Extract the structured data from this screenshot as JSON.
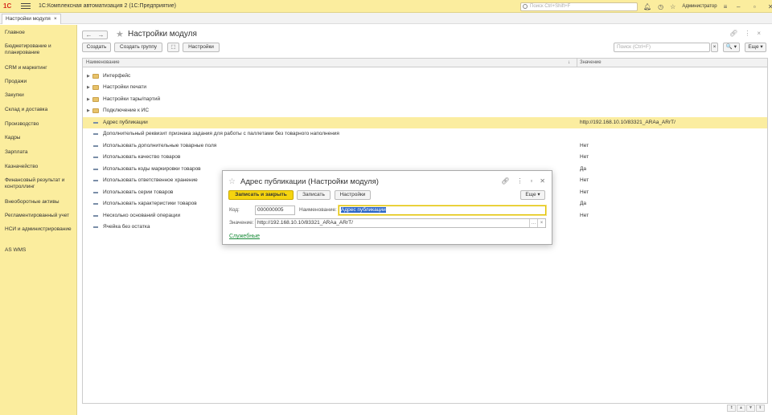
{
  "app": {
    "title": "1С:Комплексная автоматизация 2  (1С:Предприятие)",
    "logo": "1С",
    "search_placeholder": "Поиск Ctrl+Shift+F",
    "user": "Администратор"
  },
  "tabs": [
    {
      "label": "Настройки модуля"
    }
  ],
  "sidebar": {
    "items": [
      {
        "label": "Главное"
      },
      {
        "label": "Бюджетирование и планирование"
      },
      {
        "label": "CRM и маркетинг"
      },
      {
        "label": "Продажи"
      },
      {
        "label": "Закупки"
      },
      {
        "label": "Склад и доставка"
      },
      {
        "label": "Производство"
      },
      {
        "label": "Кадры"
      },
      {
        "label": "Зарплата"
      },
      {
        "label": "Казначейство"
      },
      {
        "label": "Финансовый результат и контроллинг"
      },
      {
        "label": "Внеоборотные активы"
      },
      {
        "label": "Регламентированный учет"
      },
      {
        "label": "НСИ и администрирование"
      },
      {
        "label": "AS WMS"
      }
    ]
  },
  "page": {
    "title": "Настройки модуля",
    "toolbar": {
      "create": "Создать",
      "create_group": "Создать группу",
      "settings": "Настройки",
      "search_placeholder": "Поиск (Ctrl+F)",
      "search_btn": "🔍 ▾",
      "more": "Еще ▾"
    },
    "table": {
      "columns": [
        "Наименование",
        "Значение"
      ],
      "sort_indicator": "↓",
      "rows": [
        {
          "name": "Интерфейс",
          "type": "folder",
          "value": ""
        },
        {
          "name": "Настройки печати",
          "type": "folder",
          "value": ""
        },
        {
          "name": "Настройки тары/партий",
          "type": "folder",
          "value": ""
        },
        {
          "name": "Подключение к ИС",
          "type": "folder",
          "value": ""
        },
        {
          "name": "Адрес публикации",
          "type": "item",
          "value": "http://192.168.10.10/83321_ARAa_ARrT/"
        },
        {
          "name": "Дополнительный реквизит признака задания для работы с паллетами без товарного наполнения",
          "type": "item",
          "value": ""
        },
        {
          "name": "Использовать дополнительные товарные поля",
          "type": "item",
          "value": "Нет"
        },
        {
          "name": "Использовать качество товаров",
          "type": "item",
          "value": "Нет"
        },
        {
          "name": "Использовать коды маркировки товаров",
          "type": "item",
          "value": "Да"
        },
        {
          "name": "Использовать ответственное хранение",
          "type": "item",
          "value": "Нет"
        },
        {
          "name": "Использовать серии товаров",
          "type": "item",
          "value": "Нет"
        },
        {
          "name": "Использовать характеристики товаров",
          "type": "item",
          "value": "Да"
        },
        {
          "name": "Несколько оснований операции",
          "type": "item",
          "value": "Нет"
        },
        {
          "name": "Ячейка без остатка",
          "type": "item",
          "value": ""
        }
      ]
    }
  },
  "dialog": {
    "title": "Адрес публикации (Настройки модуля)",
    "save_close": "Записать и закрыть",
    "save": "Записать",
    "settings": "Настройки",
    "more": "Еще ▾",
    "code_label": "Код:",
    "code_value": "000000005",
    "name_label": "Наименование:",
    "name_value": "Адрес публикации",
    "value_label": "Значение:",
    "value_value": "http://192.168.10.10/83321_ARAa_ARrT/",
    "service_link": "Служебные"
  }
}
